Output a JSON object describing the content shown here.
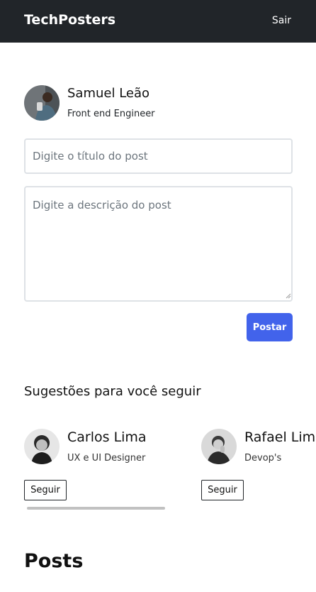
{
  "app": {
    "brand": "TechPosters",
    "logout_label": "Sair"
  },
  "profile": {
    "name": "Samuel Leão",
    "role": "Front end Engineer"
  },
  "composer": {
    "title_placeholder": "Digite o título do post",
    "description_placeholder": "Digite a descrição do post",
    "submit_label": "Postar"
  },
  "suggestions": {
    "heading": "Sugestões para você seguir",
    "users": [
      {
        "name": "Carlos Lima",
        "role": "UX e UI Designer",
        "follow_label": "Seguir"
      },
      {
        "name": "Rafael Lima",
        "role": "Devop's",
        "follow_label": "Seguir"
      }
    ]
  },
  "posts": {
    "heading": "Posts"
  },
  "colors": {
    "topbar": "#212529",
    "accent": "#4263eb"
  }
}
